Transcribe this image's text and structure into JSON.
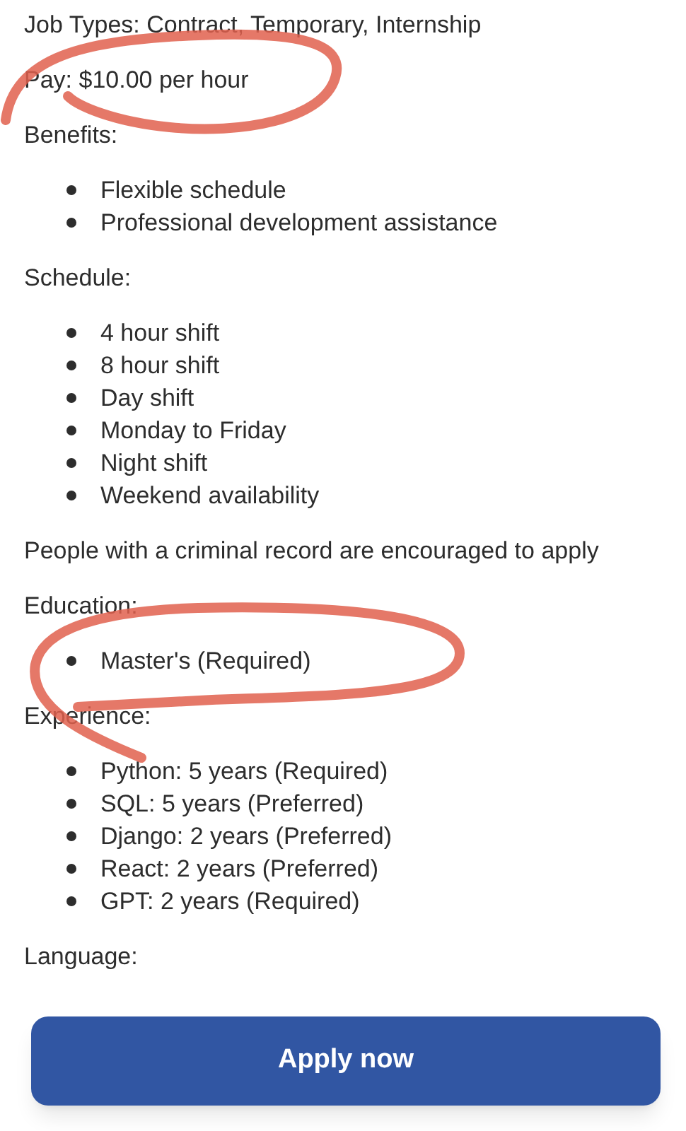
{
  "blocks": [
    {
      "kind": "text",
      "text": "Job Types: Contract, Temporary, Internship"
    },
    {
      "kind": "text",
      "text": "Pay: $10.00 per hour"
    },
    {
      "kind": "text",
      "text": "Benefits:"
    },
    {
      "kind": "list",
      "items": [
        "Flexible schedule",
        "Professional development assistance"
      ]
    },
    {
      "kind": "text",
      "text": "Schedule:"
    },
    {
      "kind": "list",
      "items": [
        "4 hour shift",
        "8 hour shift",
        "Day shift",
        "Monday to Friday",
        "Night shift",
        "Weekend availability"
      ]
    },
    {
      "kind": "text",
      "text": "People with a criminal record are encouraged to apply"
    },
    {
      "kind": "text",
      "text": "Education:"
    },
    {
      "kind": "list",
      "items": [
        "Master's (Required)"
      ]
    },
    {
      "kind": "text",
      "text": "Experience:"
    },
    {
      "kind": "list",
      "items": [
        "Python: 5 years (Required)",
        "SQL: 5 years (Preferred)",
        "Django: 2 years (Preferred)",
        "React: 2 years (Preferred)",
        "GPT: 2 years (Required)"
      ]
    },
    {
      "kind": "text",
      "text": "Language:"
    }
  ],
  "apply_button": {
    "label": "Apply now"
  }
}
